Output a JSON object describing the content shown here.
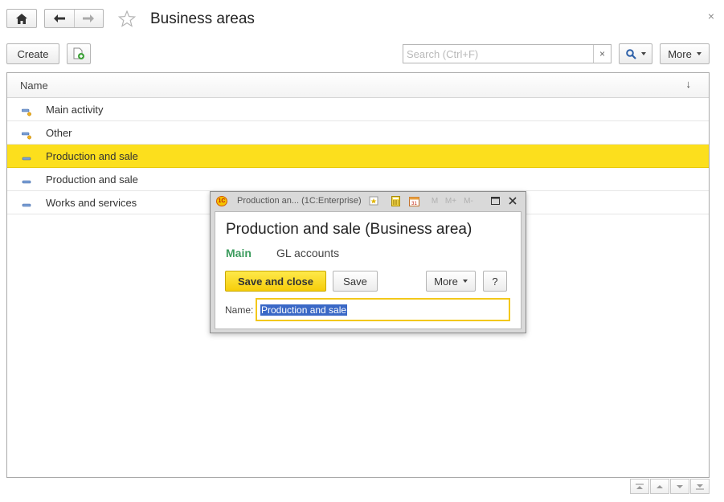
{
  "header": {
    "title": "Business areas",
    "close_glyph": "×"
  },
  "toolbar": {
    "create_label": "Create",
    "search_placeholder": "Search (Ctrl+F)",
    "search_clear": "×",
    "more_label": "More"
  },
  "list": {
    "column_name": "Name",
    "sort_indicator": "↓",
    "rows": [
      {
        "label": "Main activity",
        "icon": "group-item-icon",
        "selected": false
      },
      {
        "label": "Other",
        "icon": "group-item-icon",
        "selected": false
      },
      {
        "label": "Production and sale",
        "icon": "item-icon",
        "selected": true
      },
      {
        "label": "Production and sale",
        "icon": "item-icon",
        "selected": false
      },
      {
        "label": "Works and services",
        "icon": "item-icon",
        "selected": false
      }
    ]
  },
  "modal": {
    "window_title": "Production an...  (1C:Enterprise)",
    "logo_text": "1C",
    "heading": "Production and sale (Business area)",
    "tabs": [
      "Main",
      "GL accounts"
    ],
    "save_close_label": "Save and close",
    "save_label": "Save",
    "more_label": "More",
    "help_label": "?",
    "name_label": "Name:",
    "name_value": "Production and sale",
    "memory_buttons": [
      "M",
      "M+",
      "M-"
    ]
  },
  "colors": {
    "selection": "#fcdf1d",
    "accent_green": "#3c9c5e",
    "primary_button": "#f6cd0a",
    "text_selection": "#3a68c6"
  }
}
